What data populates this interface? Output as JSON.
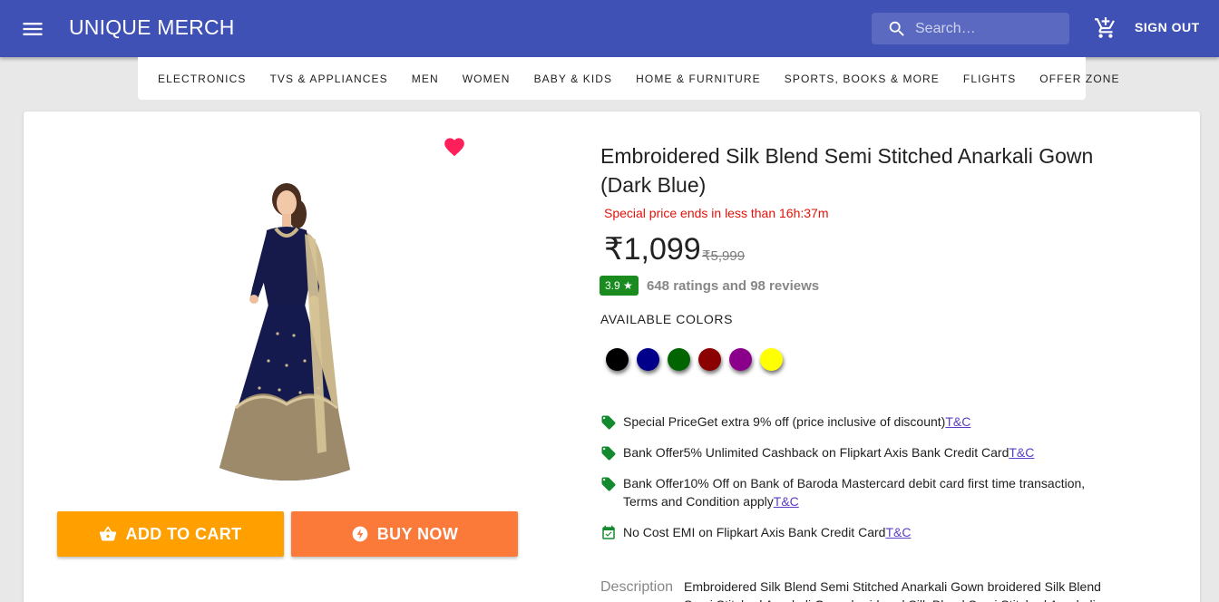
{
  "appbar": {
    "brand": "UNIQUE MERCH",
    "search_placeholder": "Search…",
    "signout_label": "SIGN OUT",
    "bg_color": "#3f51b5"
  },
  "categories": [
    "ELECTRONICS",
    "TVS & APPLIANCES",
    "MEN",
    "WOMEN",
    "BABY & KIDS",
    "HOME & FURNITURE",
    "SPORTS, BOOKS & MORE",
    "FLIGHTS",
    "OFFER ZONE"
  ],
  "product": {
    "title": "Embroidered Silk Blend Semi Stitched Anarkali Gown (Dark Blue)",
    "special_note": "Special price ends in less than 16h:37m",
    "price": "₹1,099",
    "mrp": "₹5,999",
    "rating": "3.9 ★",
    "rating_summary": "648 ratings and 98 reviews",
    "colors_label": "AVAILABLE COLORS",
    "colors": [
      "#000000",
      "#00008b",
      "#006400",
      "#8b0000",
      "#8b008b",
      "#ffff00"
    ],
    "add_to_cart": "ADD TO CART",
    "buy_now": "BUY NOW",
    "description_label": "Description",
    "description": "Embroidered Silk Blend Semi Stitched Anarkali Gown broidered Silk Blend Semi Stitched Anarkali Gown broidered Silk Blend Semi Stitched Anarkali Gown"
  },
  "offers": [
    {
      "icon": "tag-icon",
      "text": " Special PriceGet extra 9% off (price inclusive of discount)",
      "link": "T&C"
    },
    {
      "icon": "tag-icon",
      "text": "Bank Offer5% Unlimited Cashback on Flipkart Axis Bank Credit Card",
      "link": "T&C"
    },
    {
      "icon": "tag-icon",
      "text": "Bank Offer10% Off on Bank of Baroda Mastercard debit card first time transaction, Terms and Condition apply",
      "link": "T&C"
    },
    {
      "icon": "calendar-check-icon",
      "text": "No Cost EMI on Flipkart Axis Bank Credit Card",
      "link": "T&C"
    }
  ]
}
